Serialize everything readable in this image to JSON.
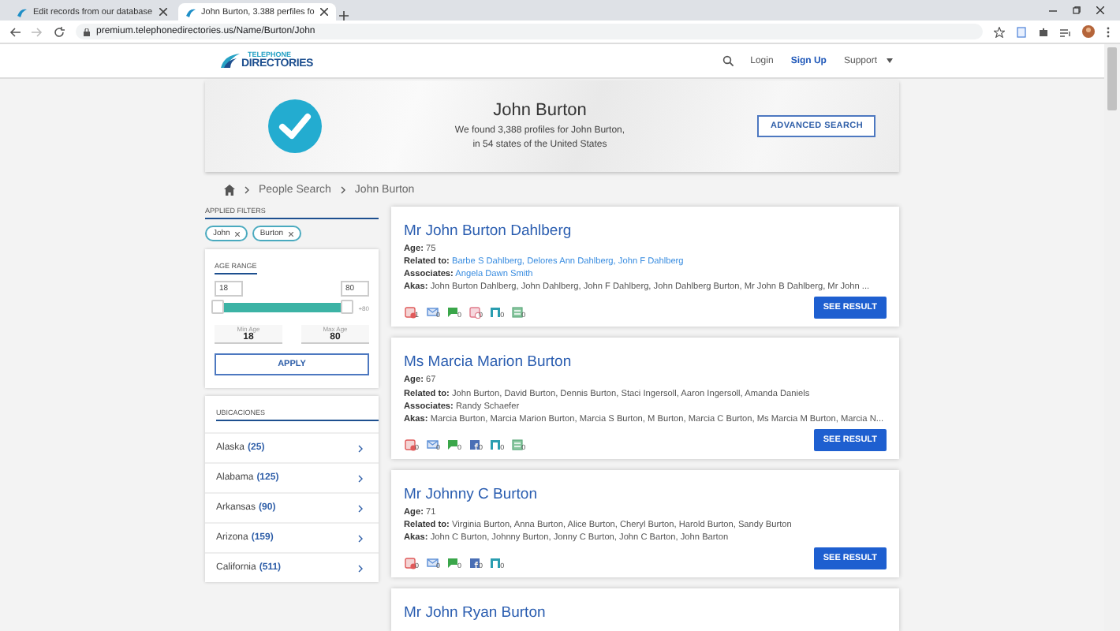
{
  "browser": {
    "tabs": [
      {
        "title": "Edit records from our database",
        "selected": false
      },
      {
        "title": "John Burton, 3.388 perfiles fo",
        "selected": true
      }
    ],
    "url": "premium.telephonedirectories.us/Name/Burton/John"
  },
  "header": {
    "logo_small": "TELEPHONE",
    "logo": "DIRECTORIES",
    "nav": [
      {
        "label": "Login",
        "kind": "link"
      },
      {
        "label": "Sign Up",
        "kind": "strong"
      },
      {
        "label": "Support",
        "kind": "menu"
      }
    ]
  },
  "hero": {
    "name": "John Burton",
    "line_1": "We found 3,388 profiles for John Burton,",
    "line_2": "in 54 states of the United States",
    "button": "ADVANCED SEARCH"
  },
  "breadcrumb": [
    "People Search",
    "John Burton"
  ],
  "filters": {
    "heading": "APPLIED FILTERS",
    "chips": [
      "John",
      "Burton"
    ]
  },
  "age_range": {
    "heading": "AGE RANGE",
    "from": "18",
    "to": "80",
    "level": 1,
    "overflow": "+80",
    "min_label": "Min Age",
    "min_value": "18",
    "max_label": "Max Age",
    "max_value": "80",
    "button": "APPLY"
  },
  "locations": {
    "heading": "UBICACIONES",
    "items": [
      {
        "name": "Alaska",
        "count": "(25)"
      },
      {
        "name": "Alabama",
        "count": "(125)"
      },
      {
        "name": "Arkansas",
        "count": "(90)"
      },
      {
        "name": "Arizona",
        "count": "(159)"
      },
      {
        "name": "California",
        "count": "(511)"
      }
    ]
  },
  "results": [
    {
      "title": "Mr John Burton Dahlberg",
      "fields": [
        {
          "label": "Age:",
          "values": [
            "75"
          ],
          "linked": false
        },
        {
          "label": "Related to:",
          "values": [
            "Barbe S Dahlberg,",
            "Delores Ann Dahlberg,",
            "John F Dahlberg"
          ],
          "linked": true
        },
        {
          "label": "Associates:",
          "values": [
            "Angela Dawn Smith"
          ],
          "linked": true
        },
        {
          "label": "Akas:",
          "values": [
            "John Burton Dahlberg, John Dahlberg, John F Dahlberg, John Dahlberg Burton, Mr John B Dahlberg, Mr John ..."
          ],
          "linked": false
        }
      ],
      "icons": [
        {
          "kind": "phone",
          "count": "1"
        },
        {
          "kind": "email",
          "count": "0"
        },
        {
          "kind": "chat",
          "count": "0"
        },
        {
          "kind": "alert",
          "count": "0"
        },
        {
          "kind": "address",
          "count": "0"
        },
        {
          "kind": "record",
          "count": "0"
        }
      ],
      "button": "SEE RESULT"
    },
    {
      "title": "Ms Marcia Marion Burton",
      "fields": [
        {
          "label": "Age:",
          "values": [
            "67"
          ],
          "linked": false
        },
        {
          "label": "Related to:",
          "values": [
            "John Burton, David Burton, Dennis Burton, Staci Ingersoll, Aaron Ingersoll, Amanda Daniels"
          ],
          "linked": false
        },
        {
          "label": "Associates:",
          "values": [
            "Randy Schaefer"
          ],
          "linked": false
        },
        {
          "label": "Akas:",
          "values": [
            "Marcia Burton, Marcia Marion Burton, Marcia S Burton, M Burton, Marcia C Burton, Ms Marcia M Burton, Marcia N..."
          ],
          "linked": false
        }
      ],
      "icons": [
        {
          "kind": "phone",
          "count": "0"
        },
        {
          "kind": "email",
          "count": "0"
        },
        {
          "kind": "chat",
          "count": "0"
        },
        {
          "kind": "social",
          "count": "0"
        },
        {
          "kind": "address",
          "count": "0"
        },
        {
          "kind": "record",
          "count": "0"
        }
      ],
      "button": "SEE RESULT"
    },
    {
      "title": "Mr Johnny C Burton",
      "fields": [
        {
          "label": "Age:",
          "values": [
            "71"
          ],
          "linked": false
        },
        {
          "label": "Related to:",
          "values": [
            "Virginia Burton, Anna Burton, Alice Burton, Cheryl Burton, Harold Burton, Sandy Burton"
          ],
          "linked": false
        },
        {
          "label": "Akas:",
          "values": [
            "John C Burton, Johnny Burton, Jonny C Burton, John C Barton, John Barton"
          ],
          "linked": false
        }
      ],
      "icons": [
        {
          "kind": "phone",
          "count": "0"
        },
        {
          "kind": "email",
          "count": "0"
        },
        {
          "kind": "chat",
          "count": "0"
        },
        {
          "kind": "social",
          "count": "0"
        },
        {
          "kind": "address",
          "count": "0"
        }
      ],
      "button": "SEE RESULT"
    },
    {
      "title": "Mr John Ryan Burton"
    }
  ]
}
